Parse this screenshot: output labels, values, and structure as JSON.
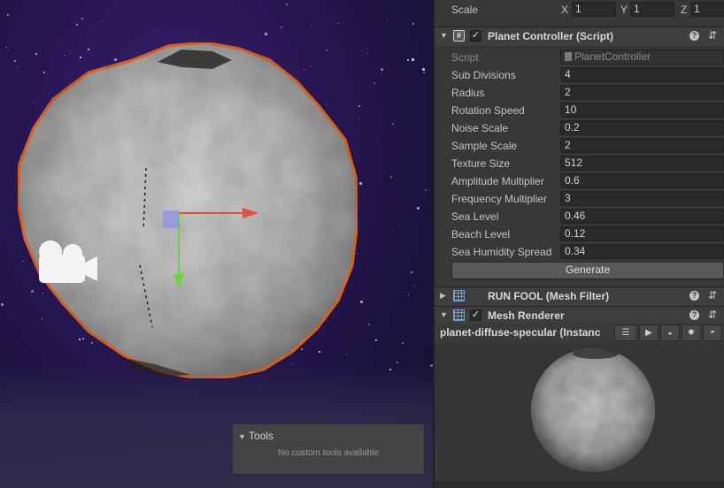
{
  "tools": {
    "title": "Tools",
    "message": "No custom tools available"
  },
  "transform": {
    "scale_label": "Scale",
    "x_label": "X",
    "x_value": "1",
    "y_label": "Y",
    "y_value": "1",
    "z_label": "Z",
    "z_value": "1"
  },
  "planet_controller": {
    "title": "Planet Controller (Script)",
    "script_label": "Script",
    "script_value": "PlanetController",
    "fields": [
      {
        "label": "Sub Divisions",
        "value": "4"
      },
      {
        "label": "Radius",
        "value": "2"
      },
      {
        "label": "Rotation Speed",
        "value": "10"
      },
      {
        "label": "Noise Scale",
        "value": "0.2"
      },
      {
        "label": "Sample Scale",
        "value": "2"
      },
      {
        "label": "Texture Size",
        "value": "512"
      },
      {
        "label": "Amplitude Multiplier",
        "value": "0.6"
      },
      {
        "label": "Frequency Multiplier",
        "value": "3"
      },
      {
        "label": "Sea Level",
        "value": "0.46"
      },
      {
        "label": "Beach Level",
        "value": "0.12"
      },
      {
        "label": "Sea Humidity Spread",
        "value": "0.34"
      }
    ],
    "generate_label": "Generate"
  },
  "mesh_filter": {
    "title": "RUN FOOL (Mesh Filter)"
  },
  "mesh_renderer": {
    "title": "Mesh Renderer"
  },
  "material": {
    "name": "planet-diffuse-specular (Instanc"
  },
  "colors": {
    "selection_outline": "#f26a1b",
    "gizmo_x": "#e0503a",
    "gizmo_y": "#6fd23a",
    "gizmo_center": "#8a8ee6",
    "scene_background": "#251650"
  }
}
